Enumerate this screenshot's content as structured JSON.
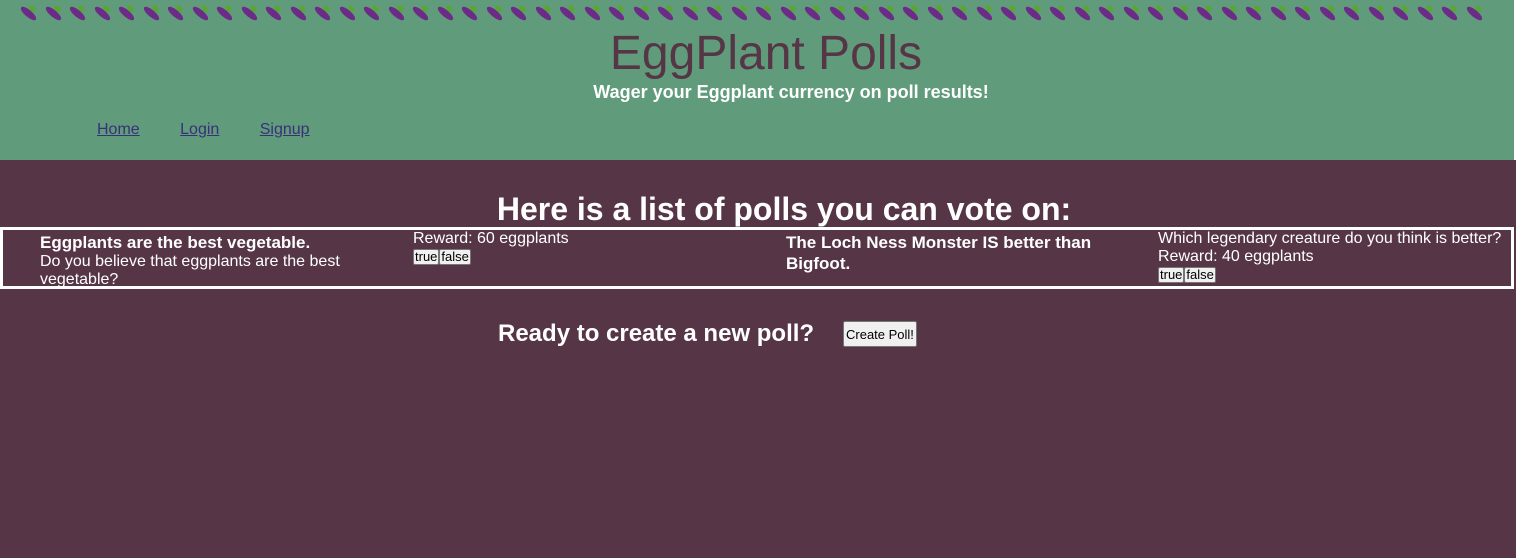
{
  "header": {
    "emoji_icon": "eggplant-emoji-icon",
    "title": "EggPlant Polls",
    "tagline": "Wager your Eggplant currency on poll results!",
    "colors": {
      "header_bg": "#609c7b",
      "title": "#563646",
      "page_bg": "#563646"
    }
  },
  "nav": {
    "home": "Home",
    "login": "Login",
    "signup": "Signup"
  },
  "main": {
    "heading": "Here is a list of polls you can vote on:",
    "polls": [
      {
        "title": "Eggplants are the best vegetable.",
        "question": "Do you believe that eggplants are the best vegetable?",
        "reward": "Reward: 60 eggplants",
        "true_label": "true",
        "false_label": "false"
      },
      {
        "title": "The Loch Ness Monster IS better than Bigfoot.",
        "question": "Which legendary creature do you think is better?",
        "reward": "Reward: 40 eggplants",
        "true_label": "true",
        "false_label": "false"
      }
    ],
    "create_prompt": "Ready to create a new poll?",
    "create_button": "Create Poll!"
  }
}
